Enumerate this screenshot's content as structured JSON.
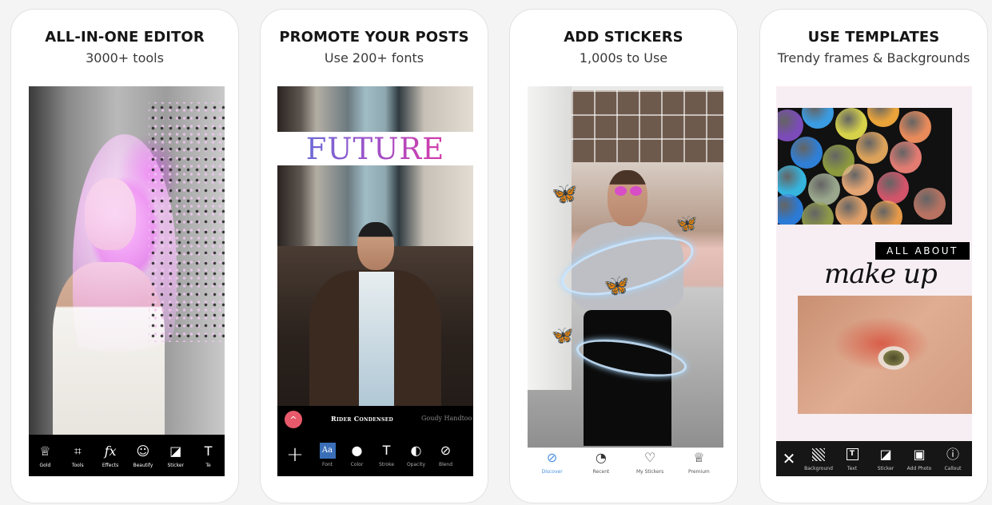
{
  "cards": [
    {
      "title": "ALL-IN-ONE EDITOR",
      "subtitle": "3000+ tools",
      "toolbar": [
        {
          "icon": "crown-icon",
          "glyph": "♕",
          "label": "Gold"
        },
        {
          "icon": "crop-icon",
          "glyph": "⌗",
          "label": "Tools"
        },
        {
          "icon": "fx-icon",
          "glyph": "fx",
          "label": "Effects"
        },
        {
          "icon": "beautify-icon",
          "glyph": "☺",
          "label": "Beautify"
        },
        {
          "icon": "sticker-icon",
          "glyph": "◪",
          "label": "Sticker"
        },
        {
          "icon": "text-icon",
          "glyph": "T",
          "label": "Te"
        }
      ]
    },
    {
      "title": "PROMOTE YOUR POSTS",
      "subtitle": "Use 200+ fonts",
      "overlay_text": "FUTURE",
      "font_options": [
        "Rider Condensed",
        "Goudy Handtoo"
      ],
      "add_glyph": "+",
      "collapse_glyph": "^",
      "toolbar": [
        {
          "icon": "font-icon",
          "glyph": "Aa",
          "label": "Font"
        },
        {
          "icon": "color-icon",
          "glyph": "●",
          "label": "Color"
        },
        {
          "icon": "stroke-icon",
          "glyph": "T",
          "label": "Stroke"
        },
        {
          "icon": "opacity-icon",
          "glyph": "◐",
          "label": "Opacity"
        },
        {
          "icon": "blend-icon",
          "glyph": "⊘",
          "label": "Blend"
        }
      ]
    },
    {
      "title": "ADD STICKERS",
      "subtitle": "1,000s to Use",
      "sticker_glyph": "🦋",
      "toolbar": [
        {
          "icon": "compass-icon",
          "glyph": "⊘",
          "label": "Discover",
          "active": true
        },
        {
          "icon": "recent-icon",
          "glyph": "◔",
          "label": "Recent"
        },
        {
          "icon": "heart-icon",
          "glyph": "♡",
          "label": "My Stickers"
        },
        {
          "icon": "crown-icon",
          "glyph": "♕",
          "label": "Premium"
        }
      ]
    },
    {
      "title": "USE TEMPLATES",
      "subtitle": "Trendy frames & Backgrounds",
      "overlay_label": "ALL ABOUT",
      "overlay_script": "make up",
      "close_glyph": "✕",
      "toolbar": [
        {
          "icon": "background-icon",
          "glyph": "",
          "label": "Background"
        },
        {
          "icon": "text-icon",
          "glyph": "T",
          "label": "Text"
        },
        {
          "icon": "sticker-icon",
          "glyph": "◪",
          "label": "Sticker"
        },
        {
          "icon": "add-photo-icon",
          "glyph": "▣",
          "label": "Add Photo"
        },
        {
          "icon": "callout-icon",
          "glyph": "ⓘ",
          "label": "Callout"
        }
      ]
    }
  ],
  "palette_colors": [
    "#7b4bb8",
    "#3a9be0",
    "#d6d24a",
    "#e9a33a",
    "#e88a5a",
    "#2f7fd6",
    "#8c9a3d",
    "#dca25a",
    "#e27b72",
    "#35b4de",
    "#9aa78c",
    "#e2a472",
    "#d2546a",
    "#2a7ad6",
    "#8e9a48",
    "#e0a068",
    "#e59a4a",
    "#b87262"
  ]
}
